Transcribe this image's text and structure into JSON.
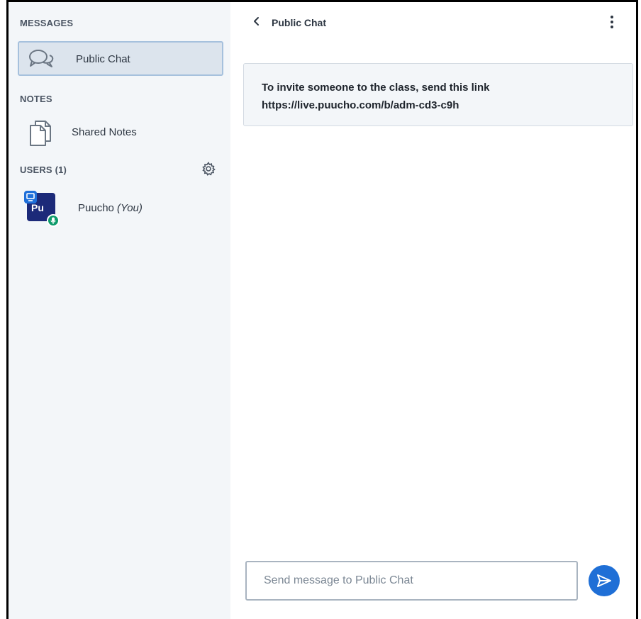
{
  "sidebar": {
    "messages_title": "MESSAGES",
    "public_chat_label": "Public Chat",
    "notes_title": "NOTES",
    "shared_notes_label": "Shared Notes",
    "users_title": "USERS (1)",
    "user": {
      "initials": "Pu",
      "name": "Puucho",
      "you_label": "(You)"
    }
  },
  "chat": {
    "back_icon": "chevron-left-icon",
    "title": "Public Chat",
    "welcome_line1": "To invite someone to the class, send this link",
    "welcome_line2": "https://live.puucho.com/b/adm-cd3-c9h",
    "input_placeholder": "Send message to Public Chat"
  },
  "colors": {
    "sidebar_bg": "#f3f6f9",
    "active_item_bg": "#dce4ed",
    "accent": "#1f6fd6",
    "avatar_bg": "#1c2a79",
    "mic_green": "#0d9b6b"
  }
}
